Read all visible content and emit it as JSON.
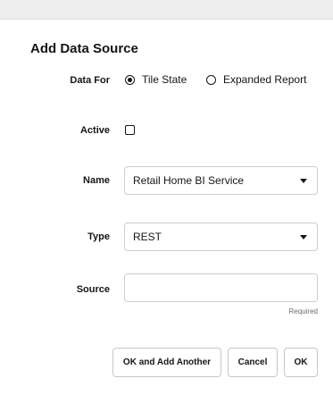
{
  "dialog": {
    "title": "Add Data Source"
  },
  "data_for": {
    "label": "Data For",
    "options": [
      {
        "label": "Tile State",
        "selected": true
      },
      {
        "label": "Expanded Report",
        "selected": false
      }
    ]
  },
  "active": {
    "label": "Active",
    "checked": false
  },
  "name": {
    "label": "Name",
    "value": "Retail Home BI Service"
  },
  "type": {
    "label": "Type",
    "value": "REST"
  },
  "source": {
    "label": "Source",
    "value": "",
    "hint": "Required"
  },
  "buttons": {
    "ok_add_another": "OK and Add Another",
    "cancel": "Cancel",
    "ok": "OK"
  }
}
